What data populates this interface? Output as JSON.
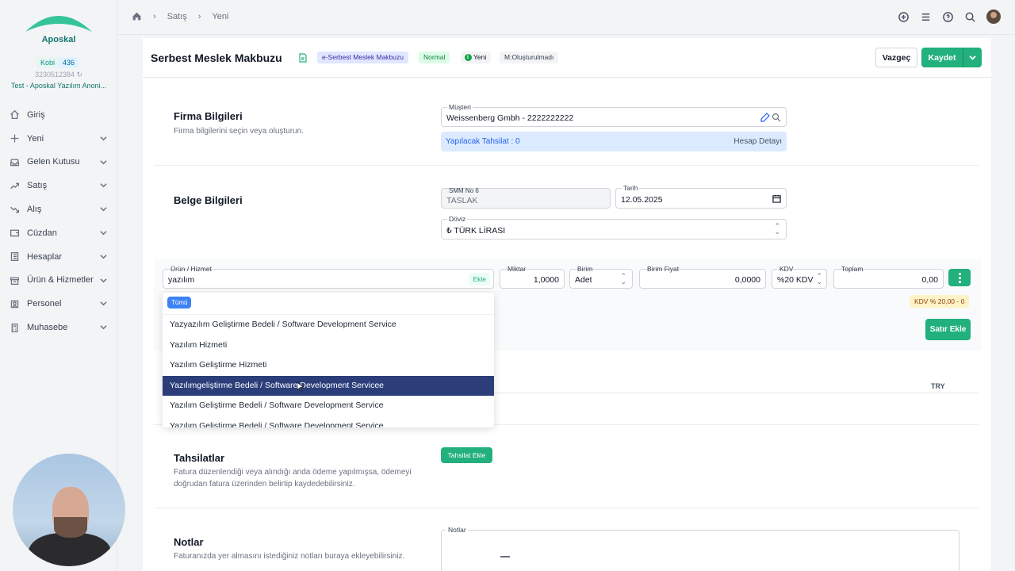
{
  "sidebar": {
    "brand": "Aposkal",
    "plan": {
      "name": "Kobi",
      "count": "436"
    },
    "tax_no": "3230512384",
    "company": "Test - Aposkal Yazılım Anoni...",
    "items": [
      {
        "label": "Giriş",
        "icon": "home-icon"
      },
      {
        "label": "Yeni",
        "icon": "plus-icon"
      },
      {
        "label": "Gelen Kutusu",
        "icon": "inbox-icon"
      },
      {
        "label": "Satış",
        "icon": "trend-icon"
      },
      {
        "label": "Alış",
        "icon": "trend-down-icon"
      },
      {
        "label": "Cüzdan",
        "icon": "wallet-icon"
      },
      {
        "label": "Hesaplar",
        "icon": "ledger-icon"
      },
      {
        "label": "Ürün & Hizmetler",
        "icon": "box-icon"
      },
      {
        "label": "Personel",
        "icon": "user-icon"
      },
      {
        "label": "Muhasebe",
        "icon": "calculator-icon"
      }
    ]
  },
  "breadcrumb": {
    "items": [
      "Satış",
      "Yeni"
    ]
  },
  "header": {
    "title": "Serbest Meslek Makbuzu",
    "badge_type": "e-Serbest Meslek Makbuzu",
    "badge_normal": "Normal",
    "badge_status": "Yeni",
    "badge_m": "M:Oluşturulmadı",
    "cancel_label": "Vazgeç",
    "save_label": "Kaydet"
  },
  "company_section": {
    "title": "Firma Bilgileri",
    "desc": "Firma bilgilerini seçin veya oluşturun.",
    "customer_label": "Müşteri",
    "customer_value": "Weissenberg Gmbh - 2222222222",
    "collection_text": "Yapılacak Tahsilat : 0",
    "account_detail": "Hesap Detayı"
  },
  "document_section": {
    "title": "Belge Bilgileri",
    "smm_label": "SMM No 6",
    "smm_value": "TASLAK",
    "date_label": "Tarih",
    "date_value": "12.05.2025",
    "currency_label": "Döviz",
    "currency_value": "₺ TÜRK LİRASI"
  },
  "line_item": {
    "product_label": "Ürün / Hizmet",
    "product_value": "yazılım",
    "add_label": "Ekle",
    "qty_label": "Miktar",
    "qty_value": "1,0000",
    "unit_label": "Birim",
    "unit_value": "Adet",
    "price_label": "Birim Fiyat",
    "price_value": "0,0000",
    "kdv_label": "KDV",
    "kdv_value": "%20 KDV",
    "total_label": "Toplam",
    "total_value": "0,00",
    "kdv_summary": "KDV % 20,00 - 0",
    "add_row_label": "Satır Ekle",
    "currency_code": "TRY"
  },
  "dropdown": {
    "filter_chip": "Tümü",
    "options": [
      "Yazyazılım Geliştirme Bedeli / Software Development Service",
      "Yazılım Hizmeti",
      "Yazılım Geliştirme Hizmeti",
      "Yazılımgeliştirme Bedeli / Software Development Servicee",
      "Yazılım Geliştirme Bedeli / Software Development Service",
      "Yazılım Geliştirme Bedeli / Software Development Service"
    ],
    "active_index": 3
  },
  "payments_section": {
    "title": "Tahsilatlar",
    "desc": "Fatura düzenlendiği veya alındığı anda ödeme yapılmışsa, ödemeyi doğrudan fatura üzerinden belirtip kaydedebilirsiniz.",
    "button": "Tahsilat Ekle"
  },
  "notes_section": {
    "title": "Notlar",
    "desc": "Faturanızda yer almasını istediğiniz notları buraya ekleyebilirsiniz.",
    "field_label": "Notlar"
  },
  "colors": {
    "accent": "#22b07d",
    "brand": "#0f766e",
    "selected": "#2c3e7a"
  }
}
